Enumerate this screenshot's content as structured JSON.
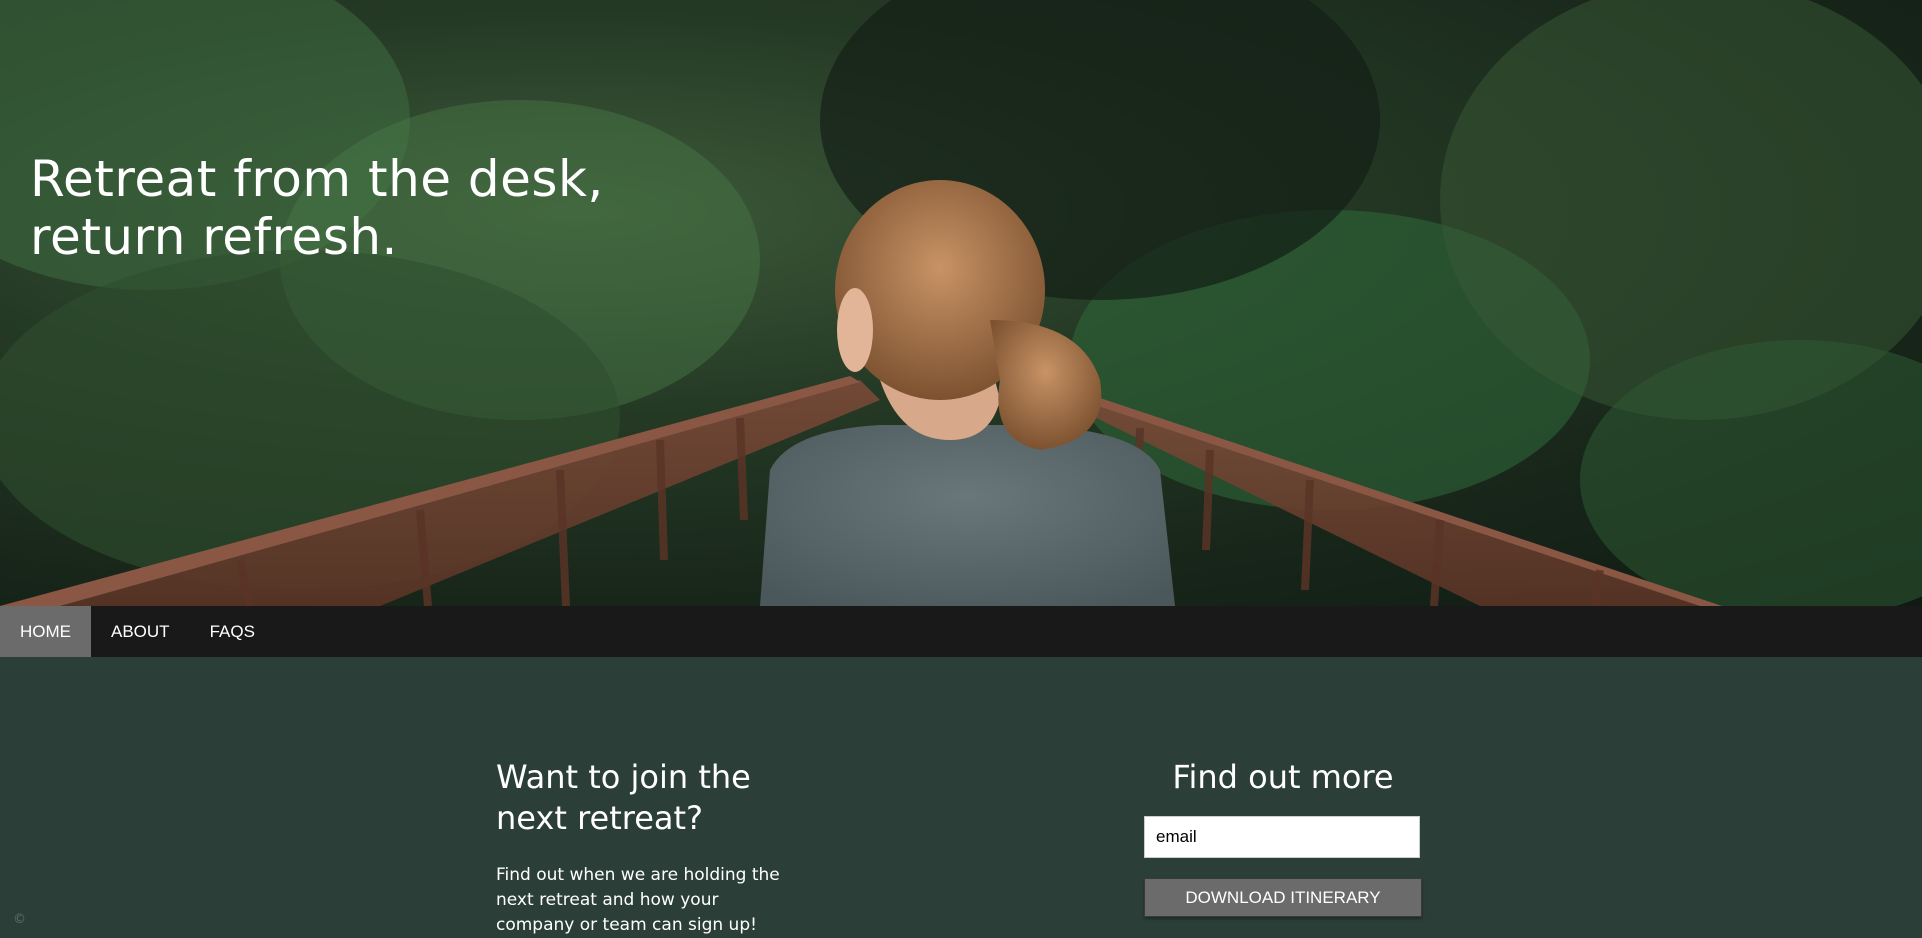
{
  "hero": {
    "title": "Retreat from the desk, return refresh."
  },
  "nav": {
    "items": [
      {
        "label": "HOME",
        "active": true
      },
      {
        "label": "ABOUT",
        "active": false
      },
      {
        "label": "FAQS",
        "active": false
      }
    ]
  },
  "join": {
    "title": "Want to join the next retreat?",
    "text": "Find out when we are holding the next retreat and how your company or team can sign up!"
  },
  "more": {
    "title": "Find out more",
    "email_value": "email",
    "download_label": "DOWNLOAD ITINERARY"
  },
  "colors": {
    "nav_bg": "#191919",
    "nav_active": "#6b6b6b",
    "content_bg": "#2b3f38",
    "button_bg": "#6b6b6b"
  },
  "icons": {
    "corner": "copyright-icon"
  }
}
